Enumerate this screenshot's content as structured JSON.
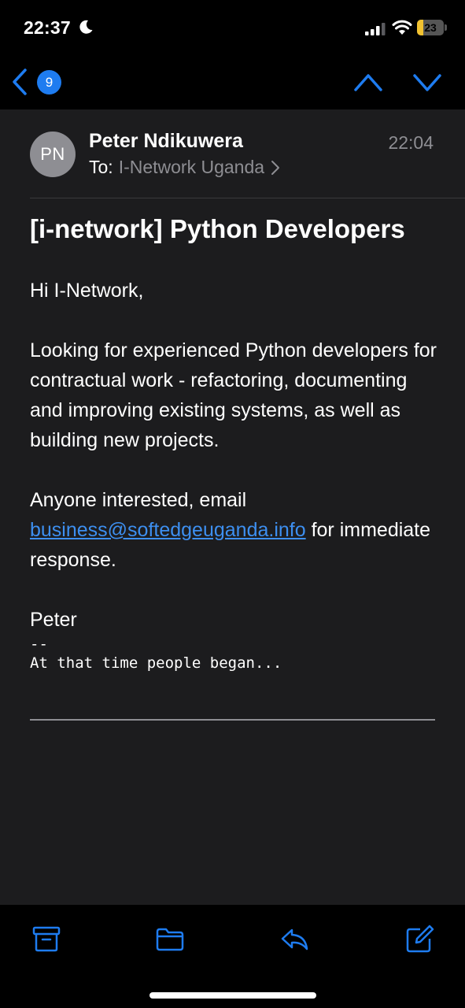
{
  "status_bar": {
    "time": "22:37",
    "battery_level": "23",
    "battery_fraction": 0.23,
    "accent_battery": "#f2c230"
  },
  "nav": {
    "back_badge": "9",
    "accent": "#1e7cf0"
  },
  "email": {
    "sender_initials": "PN",
    "sender_name": "Peter Ndikuwera",
    "time": "22:04",
    "to_label": "To:",
    "to_name": "I-Network Uganda",
    "subject": "[i-network] Python Developers",
    "greeting": "Hi I-Network,",
    "paragraph_1": "Looking for experienced Python developers for contractual work - refactoring, documenting and improving existing systems, as well as building new projects.",
    "paragraph_2_prefix": "Anyone interested, email ",
    "paragraph_2_link": "business@softedgeuganda.info",
    "paragraph_2_suffix": " for immediate response.",
    "signature_name": "Peter",
    "signature_separator": "--",
    "signature_quote": "At that time people began..."
  },
  "toolbar": {
    "icons": [
      "archive-icon",
      "folder-icon",
      "reply-icon",
      "compose-icon"
    ]
  }
}
